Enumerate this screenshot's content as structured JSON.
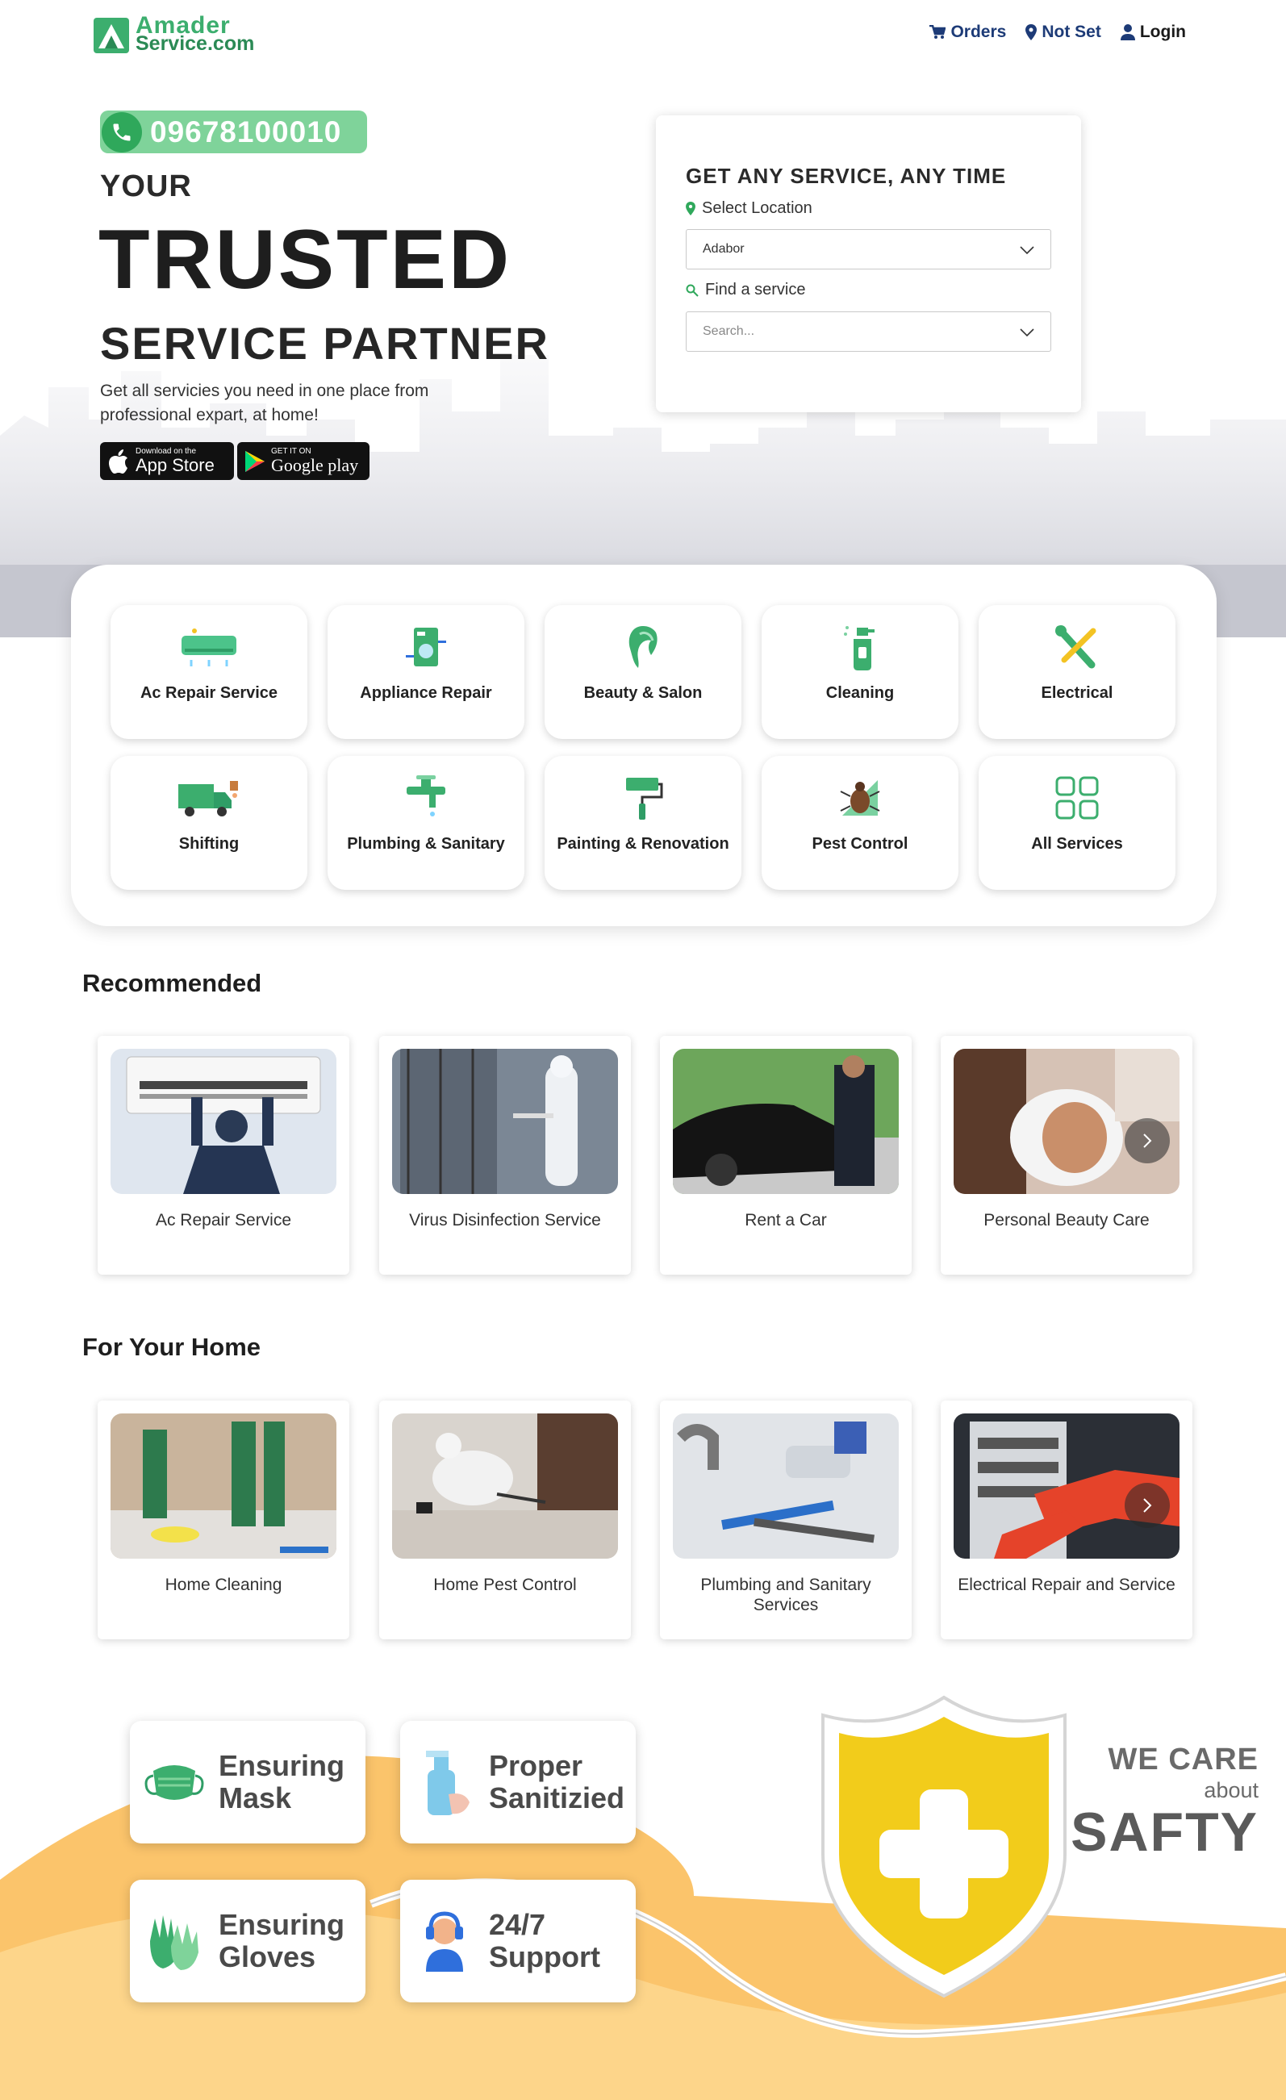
{
  "brand": {
    "name_line1": "Amader",
    "name_line2": "Service.com",
    "color": "#3cae6e"
  },
  "nav": {
    "orders": "Orders",
    "location": "Not Set",
    "login": "Login"
  },
  "hero": {
    "phone": "09678100010",
    "line1": "YOUR",
    "line2": "TRUSTED",
    "line3": "SERVICE PARTNER",
    "subtitle": "Get all servicies you need in one place from professional expart, at home!",
    "app_store": {
      "small": "Download on the",
      "big": "App Store"
    },
    "google_play": {
      "small": "GET IT ON",
      "big": "Google play"
    }
  },
  "search": {
    "title": "GET ANY SERVICE, ANY TIME",
    "location_label": "Select Location",
    "location_value": "Adabor",
    "service_label": "Find a service",
    "service_placeholder": "Search..."
  },
  "categories": [
    {
      "label": "Ac Repair Service",
      "icon": "ac-icon"
    },
    {
      "label": "Appliance Repair",
      "icon": "washing-machine-icon"
    },
    {
      "label": "Beauty & Salon",
      "icon": "hair-icon"
    },
    {
      "label": "Cleaning",
      "icon": "spray-bottle-icon"
    },
    {
      "label": "Electrical",
      "icon": "tools-icon"
    },
    {
      "label": "Shifting",
      "icon": "truck-icon"
    },
    {
      "label": "Plumbing & Sanitary",
      "icon": "faucet-icon"
    },
    {
      "label": "Painting & Renovation",
      "icon": "paint-roller-icon"
    },
    {
      "label": "Pest Control",
      "icon": "bug-icon"
    },
    {
      "label": "All Services",
      "icon": "grid-icon"
    }
  ],
  "recommended": {
    "title": "Recommended",
    "items": [
      {
        "label": "Ac Repair Service"
      },
      {
        "label": "Virus Disinfection Service"
      },
      {
        "label": "Rent a Car"
      },
      {
        "label": "Personal Beauty Care"
      }
    ]
  },
  "home": {
    "title": "For Your Home",
    "items": [
      {
        "label": "Home Cleaning"
      },
      {
        "label": "Home Pest Control"
      },
      {
        "label": "Plumbing and Sanitary Services"
      },
      {
        "label": "Electrical Repair and Service"
      }
    ]
  },
  "safety": {
    "mask": "Ensuring Mask",
    "sanitized": "Proper Sanitizied",
    "gloves": "Ensuring Gloves",
    "support": "24/7 Support",
    "we_care": "WE CARE",
    "about": "about",
    "safty": "SAFTY"
  },
  "colors": {
    "accent": "#3cae6e",
    "nav_blue": "#1d3b77",
    "yellow": "#f2cc1b",
    "orange": "#fbc46b"
  }
}
